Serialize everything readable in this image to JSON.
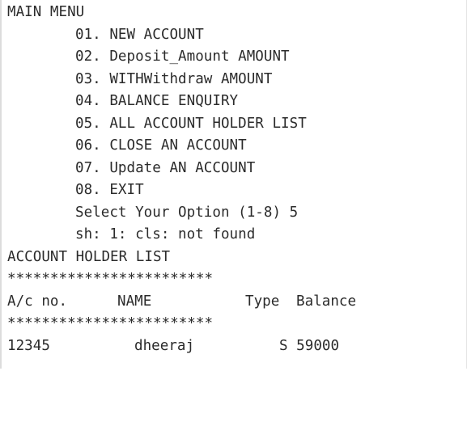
{
  "menu": {
    "title": "MAIN MENU",
    "options": [
      "01. NEW ACCOUNT",
      "02. Deposit_Amount AMOUNT",
      "03. WITHWithdraw AMOUNT",
      "04. BALANCE ENQUIRY",
      "05. ALL ACCOUNT HOLDER LIST",
      "06. CLOSE AN ACCOUNT",
      "07. Update AN ACCOUNT",
      "08. EXIT"
    ],
    "prompt": "Select Your Option (1-8) 5",
    "error": "sh: 1: cls: not found"
  },
  "list": {
    "title": "ACCOUNT HOLDER LIST",
    "separator": "************************",
    "headers": {
      "account_no": "A/c no.",
      "name": "NAME",
      "type": "Type",
      "balance": "Balance"
    },
    "rows": [
      {
        "account_no": "12345",
        "name": "dheeraj",
        "type_balance": "S 59000"
      }
    ]
  }
}
